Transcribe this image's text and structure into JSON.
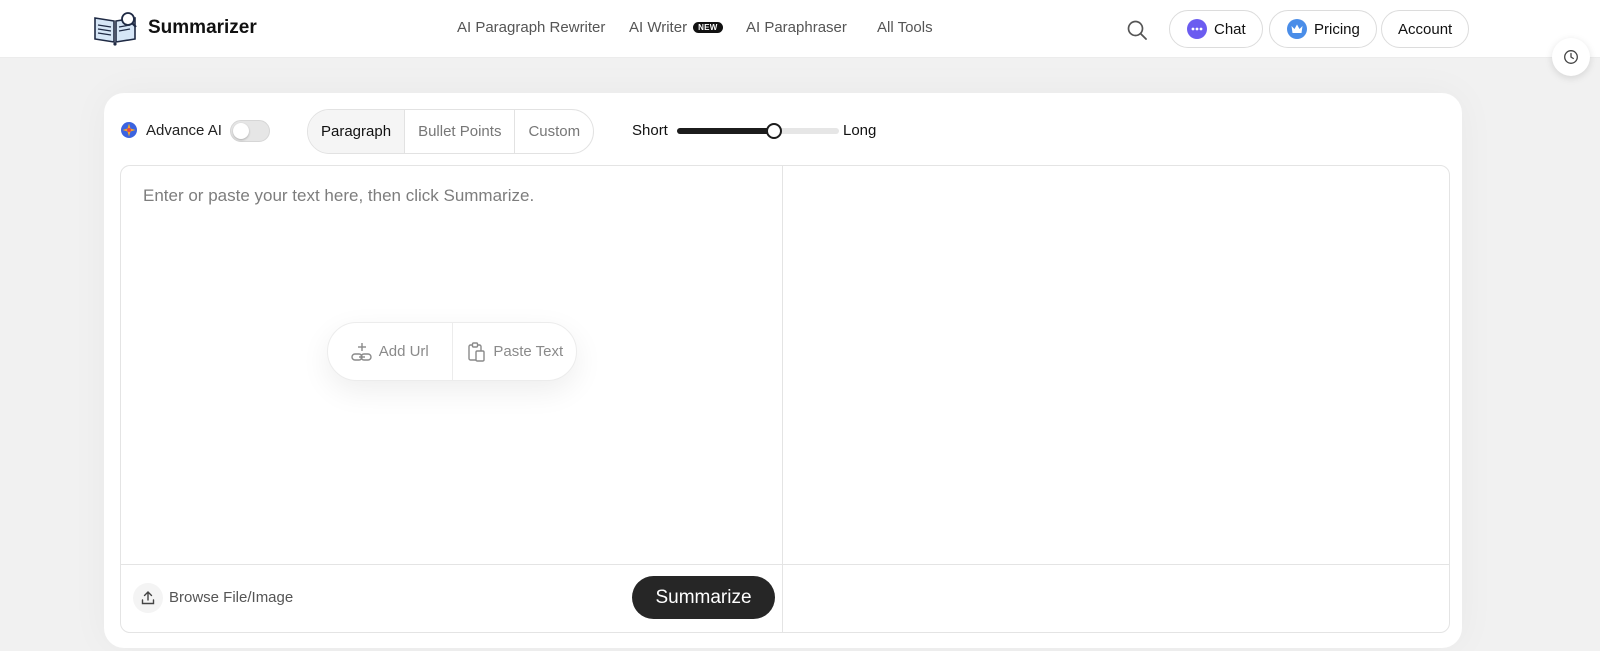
{
  "header": {
    "brand": "Summarizer",
    "nav": [
      {
        "label": "AI Paragraph Rewriter"
      },
      {
        "label": "AI Writer",
        "badge": "NEW"
      },
      {
        "label": "AI Paraphraser"
      },
      {
        "label": "All Tools"
      }
    ],
    "chat_label": "Chat",
    "pricing_label": "Pricing",
    "account_label": "Account"
  },
  "toolbar": {
    "advance_ai_label": "Advance AI",
    "advance_ai_enabled": false,
    "modes": [
      "Paragraph",
      "Bullet Points",
      "Custom"
    ],
    "active_mode": "Paragraph",
    "length_short_label": "Short",
    "length_long_label": "Long",
    "length_value": 0.6
  },
  "editor": {
    "placeholder": "Enter or paste your text here, then click Summarize.",
    "value": "",
    "add_url_label": "Add Url",
    "paste_text_label": "Paste Text",
    "browse_label": "Browse File/Image",
    "summarize_label": "Summarize"
  },
  "icons": {
    "logo": "book-magnifier-icon",
    "search": "search-icon",
    "chat": "chat-bubble-icon",
    "pricing": "crown-icon",
    "history": "clock-icon",
    "advance_ai": "sparkle-icon",
    "add_url": "link-add-icon",
    "paste_text": "clipboard-icon",
    "upload": "upload-icon"
  },
  "colors": {
    "primary_button": "#262626",
    "chat_icon": "#6b5cf0",
    "pricing_icon": "#4a8de8",
    "advance_ai_icon": "#e8434d"
  }
}
